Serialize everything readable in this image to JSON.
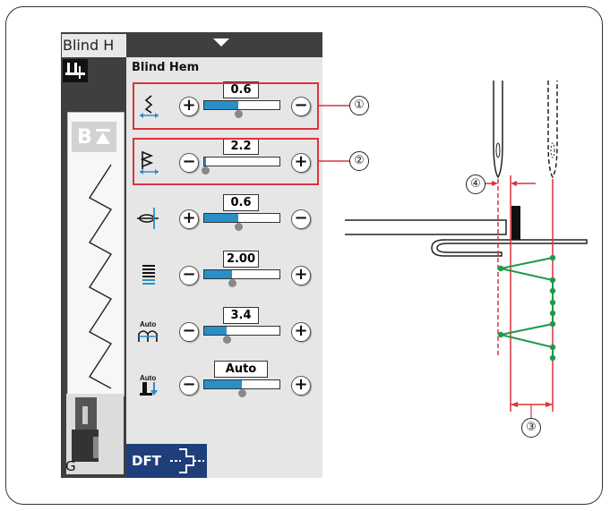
{
  "window": {
    "tab_title": "Blind H"
  },
  "panel": {
    "title": "Blind Hem"
  },
  "preview": {
    "stitch_badge": "B"
  },
  "rows": [
    {
      "value": "0.6",
      "level": 0.45,
      "left_button": "+",
      "right_button": "−",
      "icon": "stitch-width-icon"
    },
    {
      "value": "2.2",
      "level": 0.02,
      "left_button": "−",
      "right_button": "+",
      "icon": "stitch-length-icon"
    },
    {
      "value": "0.6",
      "level": 0.45,
      "left_button": "+",
      "right_button": "−",
      "icon": "needle-position-icon"
    },
    {
      "value": "2.00",
      "level": 0.37,
      "left_button": "−",
      "right_button": "+",
      "icon": "thread-density-icon"
    },
    {
      "value": "3.4",
      "level": 0.3,
      "left_button": "−",
      "right_button": "+",
      "icon": "auto-thread-tension-icon"
    },
    {
      "value": "Auto",
      "level": 0.5,
      "left_button": "−",
      "right_button": "+",
      "icon": "auto-foot-pressure-icon"
    }
  ],
  "bottom": {
    "dft_label": "DFT",
    "hem_icon": "hem-guide-icon"
  },
  "foot": {
    "letter": "G"
  },
  "callouts": [
    "①",
    "②",
    "③",
    "④"
  ],
  "colors": {
    "accent": "#2a8fc7",
    "highlight": "#d9343c",
    "stitch": "#1e9a48",
    "bar": "#3f3f3f"
  }
}
